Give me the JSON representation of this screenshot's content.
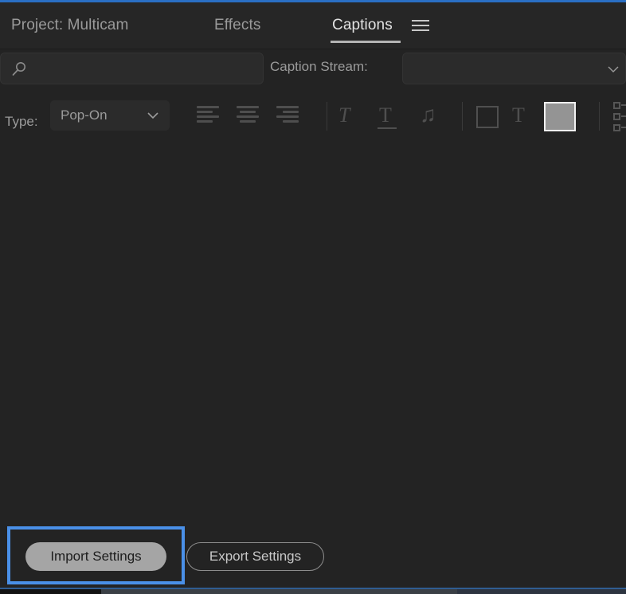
{
  "window": {
    "accent_color": "#2a6fc4",
    "highlight_color": "#4a90e8",
    "panel_background": "#232323"
  },
  "tabs": [
    {
      "id": "project",
      "label": "Project: Multicam",
      "active": false
    },
    {
      "id": "effects",
      "label": "Effects",
      "active": false
    },
    {
      "id": "captions",
      "label": "Captions",
      "active": true
    }
  ],
  "panel_menu": {
    "icon": "hamburger-menu-icon",
    "label": "Panel Menu"
  },
  "search": {
    "icon": "search-icon",
    "value": "",
    "placeholder": ""
  },
  "caption_stream": {
    "label": "Caption Stream:",
    "value": "",
    "chevron": "chevron-down-icon"
  },
  "toolbar": {
    "type_label": "Type:",
    "type_value": "Pop-On",
    "type_chevron": "chevron-down-icon",
    "align_left": "align-left-icon",
    "align_center": "align-center-icon",
    "align_right": "align-right-icon",
    "italic": "italic-text-icon",
    "underline": "underline-text-icon",
    "music_note": "music-note-icon",
    "background_box": "background-color-icon",
    "text_color": "text-color-icon",
    "color_swatch_value": "#949494",
    "placement_grid": "placement-grid-icon"
  },
  "footer": {
    "import_label": "Import Settings",
    "export_label": "Export Settings"
  }
}
